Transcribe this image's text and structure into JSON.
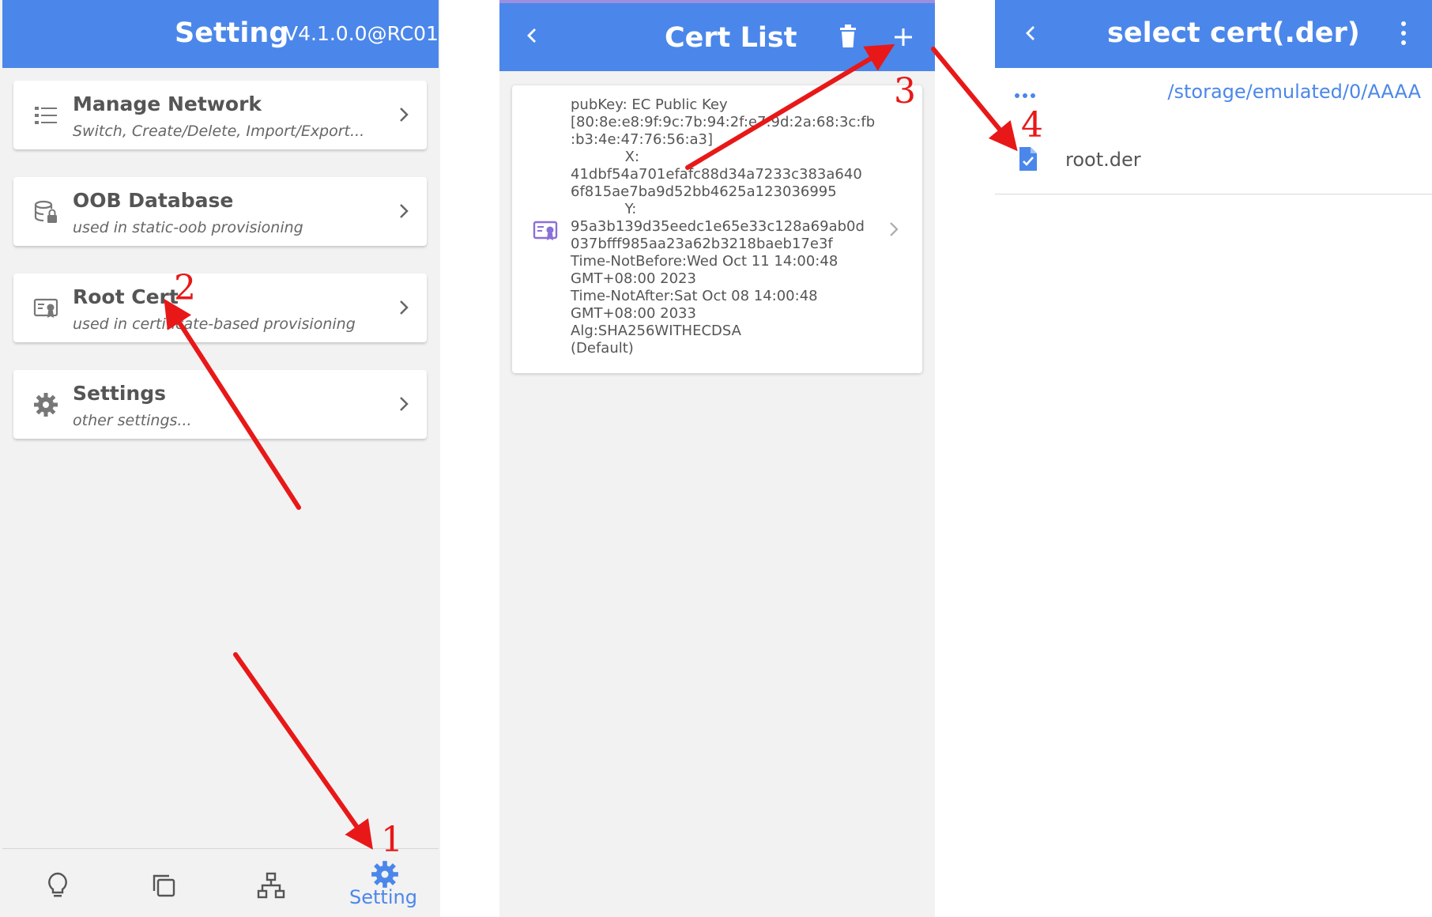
{
  "screen1": {
    "title": "Setting",
    "version": "V4.1.0.0@RC01",
    "items": [
      {
        "title": "Manage Network",
        "subtitle": "Switch, Create/Delete, Import/Export...",
        "icon": "list-icon"
      },
      {
        "title": "OOB Database",
        "subtitle": "used in static-oob provisioning",
        "icon": "database-lock-icon"
      },
      {
        "title": "Root Cert",
        "subtitle": "used in certificate-based provisioning",
        "icon": "certificate-icon"
      },
      {
        "title": "Settings",
        "subtitle": "other settings...",
        "icon": "gear-icon"
      }
    ],
    "bottom_tabs": [
      {
        "icon": "lightbulb-icon"
      },
      {
        "icon": "copy-icon"
      },
      {
        "icon": "network-icon"
      },
      {
        "icon": "gear-icon",
        "label": "Setting",
        "active": true
      }
    ]
  },
  "screen2": {
    "title": "Cert List",
    "cert_lines": [
      "pubKey: EC Public Key",
      "[80:8e:e8:9f:9c:7b:94:2f:e7:9d:2a:68:3c:fb",
      ":b3:4e:47:76:56:a3]",
      "            X:",
      "41dbf54a701efafc88d34a7233c383a640",
      "6f815ae7ba9d52bb4625a123036995",
      "            Y:",
      "95a3b139d35eedc1e65e33c128a69ab0d",
      "037bfff985aa23a62b3218baeb17e3f",
      "Time-NotBefore:Wed Oct 11 14:00:48",
      "GMT+08:00 2023",
      "Time-NotAfter:Sat Oct 08 14:00:48",
      "GMT+08:00 2033",
      "Alg:SHA256WITHECDSA",
      "(Default)"
    ]
  },
  "screen3": {
    "title": "select cert(.der)",
    "path": "/storage/emulated/0/AAAA",
    "files": [
      {
        "name": "root.der",
        "icon": "file-check-icon"
      }
    ]
  },
  "annotations": [
    "1",
    "2",
    "3",
    "4"
  ],
  "colors": {
    "primary": "#4b87ea",
    "annotation": "#e81818",
    "cert_icon": "#8a6fd8",
    "background": "#f2f2f2"
  }
}
